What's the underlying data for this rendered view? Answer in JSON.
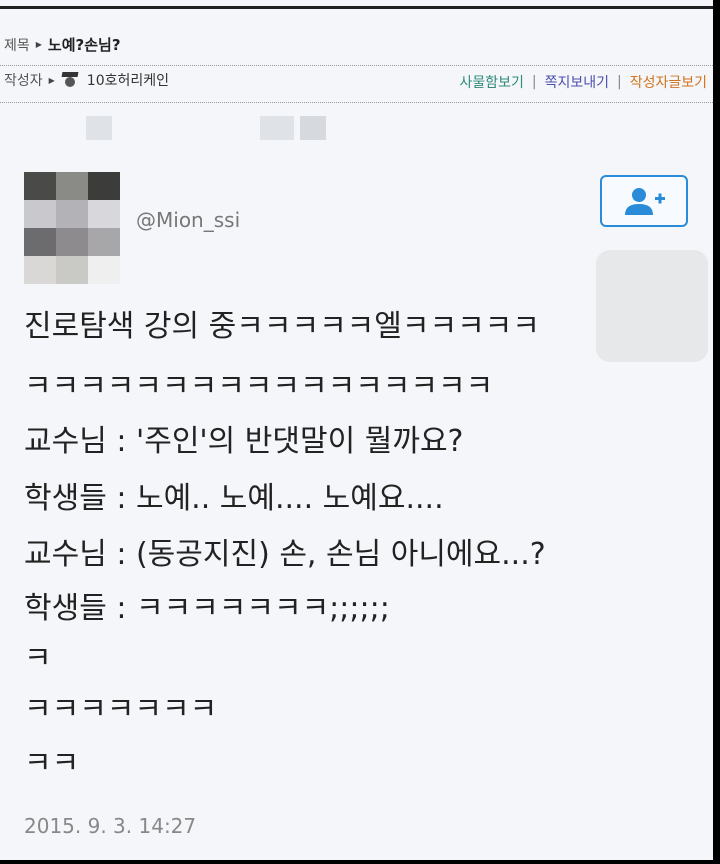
{
  "post": {
    "title_label": "제목",
    "title_value": "노예?손님?",
    "author_label": "작성자",
    "author_name": "10호허리케인",
    "links": {
      "mailbox": "사물함보기",
      "send_note": "쪽지보내기",
      "author_posts": "작성자글보기"
    },
    "separator": "|"
  },
  "tweet": {
    "handle": "@Mion_ssi",
    "lines": [
      "진로탐색 강의 중ㅋㅋㅋㅋㅋ엘ㅋㅋㅋㅋㅋ",
      "ㅋㅋㅋㅋㅋㅋㅋㅋㅋㅋㅋㅋㅋㅋㅋㅋㅋ",
      "교수님 : '주인'의 반댓말이 뭘까요?",
      "학생들 : 노예.. 노예....  노예요....",
      "교수님 : (동공지진) 손, 손님 아니에요...?",
      "학생들 : ㅋㅋㅋㅋㅋㅋㅋ;;;;;;",
      "ㅋ",
      "ㅋㅋㅋㅋㅋㅋㅋ",
      "ㅋㅋ"
    ],
    "timestamp": "2015. 9. 3. 14:27",
    "follow_icon": "add-user-icon",
    "accent_color": "#2a8bd8"
  },
  "colors": {
    "mailbox_link": "#2f8a7a",
    "note_link": "#4d4fb0",
    "posts_link": "#d2731f"
  }
}
